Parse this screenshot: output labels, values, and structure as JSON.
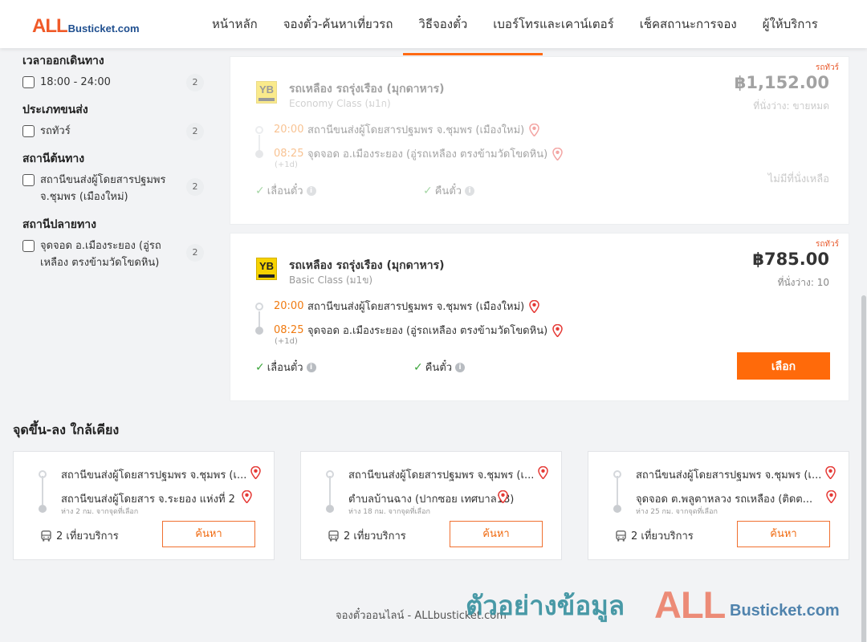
{
  "header": {
    "logo_all": "ALL",
    "logo_rest": "Busticket.com",
    "nav": [
      {
        "label": "หน้าหลัก"
      },
      {
        "label": "จองตั๋ว-ค้นหาเที่ยวรถ"
      },
      {
        "label": "วิธีจองตั๋ว"
      },
      {
        "label": "เบอร์โทรและเคาน์เตอร์"
      },
      {
        "label": "เช็คสถานะการจอง"
      },
      {
        "label": "ผู้ให้บริการ"
      }
    ],
    "active_nav_index": 2
  },
  "filters": {
    "groups": [
      {
        "title": "เวลาออกเดินทาง",
        "options": [
          {
            "label": "18:00 - 24:00",
            "count": "2"
          }
        ]
      },
      {
        "title": "ประเภทขนส่ง",
        "options": [
          {
            "label": "รถทัวร์",
            "count": "2"
          }
        ]
      },
      {
        "title": "สถานีต้นทาง",
        "options": [
          {
            "label": "สถานีขนส่งผู้โดยสารปฐมพร จ.ชุมพร (เมืองใหม่)",
            "count": "2"
          }
        ]
      },
      {
        "title": "สถานีปลายทาง",
        "options": [
          {
            "label": "จุดจอด อ.เมืองระยอง (อู่รถเหลือง ตรงข้ามวัดโขดหิน)",
            "count": "2"
          }
        ]
      }
    ]
  },
  "trips": [
    {
      "tag": "รถทัวร์",
      "operator": "รถเหลือง รถรุ่งเรือง (มุกดาหาร)",
      "bus_class": "Economy Class (ม1ก)",
      "price": "฿1,152.00",
      "seats": "ที่นั่งว่าง: ขายหมด",
      "depart_time": "20:00",
      "depart_station": "สถานีขนส่งผู้โดยสารปฐมพร จ.ชุมพร (เมืองใหม่)",
      "arrive_time": "08:25",
      "arrive_station": "จุดจอด อ.เมืองระยอง (อู่รถเหลือง ตรงข้ามวัดโขดหิน)",
      "day_offset": "(+1d)",
      "policy_postpone": "เลื่อนตั๋ว",
      "policy_refund": "คืนตั๋ว",
      "status": "ไม่มีที่นั่งเหลือ",
      "sold_out": true
    },
    {
      "tag": "รถทัวร์",
      "operator": "รถเหลือง รถรุ่งเรือง (มุกดาหาร)",
      "bus_class": "Basic Class (ม1ข)",
      "price": "฿785.00",
      "seats": "ที่นั่งว่าง: 10",
      "depart_time": "20:00",
      "depart_station": "สถานีขนส่งผู้โดยสารปฐมพร จ.ชุมพร (เมืองใหม่)",
      "arrive_time": "08:25",
      "arrive_station": "จุดจอด อ.เมืองระยอง (อู่รถเหลือง ตรงข้ามวัดโขดหิน)",
      "day_offset": "(+1d)",
      "policy_postpone": "เลื่อนตั๋ว",
      "policy_refund": "คืนตั๋ว",
      "select_label": "เลือก",
      "sold_out": false
    }
  ],
  "logo_badge": {
    "text": "YB"
  },
  "nearby": {
    "title": "จุดขึ้น-ลง ใกล้เคียง",
    "cards": [
      {
        "from": "สถานีขนส่งผู้โดยสารปฐมพร จ.ชุมพร (เ...",
        "to": "สถานีขนส่งผู้โดยสาร จ.ระยอง แห่งที่ 2",
        "distance": "ห่าง 2 กม. จากจุดที่เลือก",
        "trips": "2 เที่ยวบริการ",
        "search_label": "ค้นหา"
      },
      {
        "from": "สถานีขนส่งผู้โดยสารปฐมพร จ.ชุมพร (เ...",
        "to": "ตำบลบ้านฉาง (ปากซอย เทศบาล18)",
        "distance": "ห่าง 18 กม. จากจุดที่เลือก",
        "trips": "2 เที่ยวบริการ",
        "search_label": "ค้นหา"
      },
      {
        "from": "สถานีขนส่งผู้โดยสารปฐมพร จ.ชุมพร (เ...",
        "to": "จุดจอด ต.พลูตาหลวง รถเหลือง (ติดต...",
        "distance": "ห่าง 25 กม. จากจุดที่เลือก",
        "trips": "2 เที่ยวบริการ",
        "search_label": "ค้นหา"
      }
    ]
  },
  "footer": {
    "text": "จองตั๋วออนไลน์ - ALLbusticket.com"
  },
  "watermark": {
    "thai": "ตัวอย่างข้อมูล",
    "all": "ALL",
    "rest": "Busticket.com"
  },
  "colors": {
    "accent": "#ff6a0a",
    "time": "#f07a10",
    "pin": "#e53935",
    "check": "#3aa53a"
  }
}
